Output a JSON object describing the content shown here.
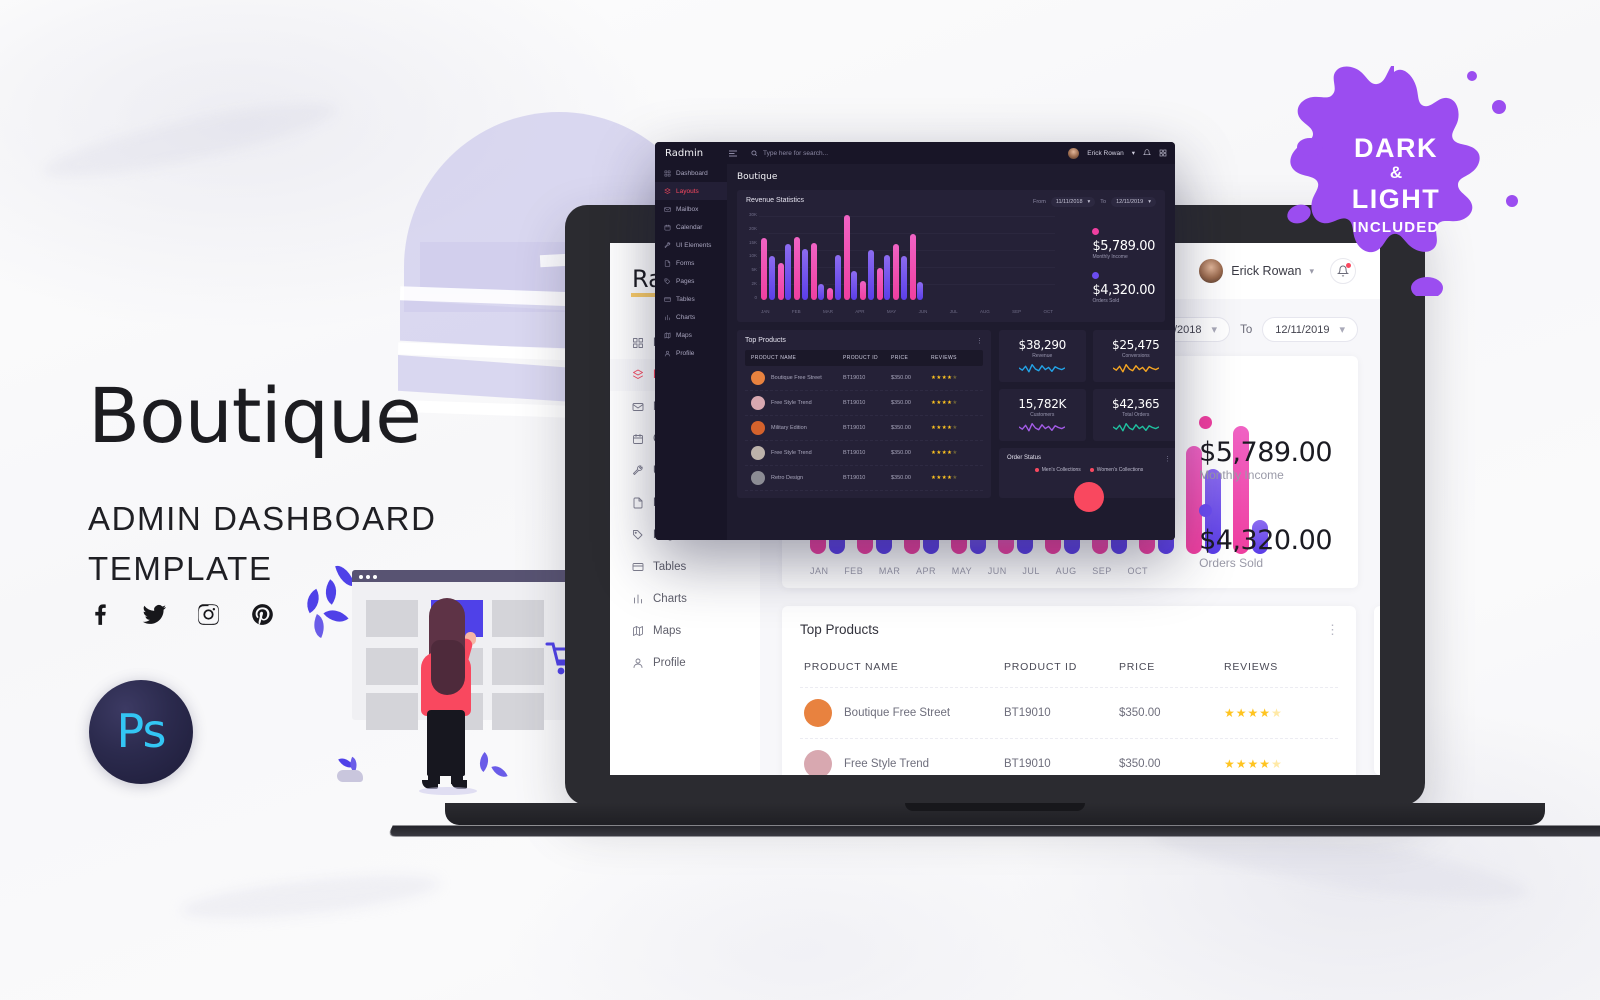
{
  "promo": {
    "brand_title": "Boutique",
    "subtitle_line1": "ADMIN DASHBOARD",
    "subtitle_line2": "TEMPLATE",
    "highlight_color": "#fbcd68",
    "social": [
      {
        "name": "facebook-icon",
        "label": "Facebook"
      },
      {
        "name": "twitter-icon",
        "label": "Twitter"
      },
      {
        "name": "instagram-icon",
        "label": "Instagram"
      },
      {
        "name": "pinterest-icon",
        "label": "Pinterest"
      }
    ],
    "photoshop_badge": "Ps"
  },
  "splat": {
    "line1": "DARK",
    "amp": "&",
    "line2": "LIGHT",
    "line3": "INCLUDED",
    "color": "#9b4df0"
  },
  "app": {
    "logo": "Radmin",
    "page_title": "Boutique",
    "search_placeholder": "Type here for search...",
    "user_name": "Erick Rowan",
    "menu": [
      {
        "label": "Dashboard",
        "icon": "grid-icon",
        "active": false
      },
      {
        "label": "Layouts",
        "icon": "layers-icon",
        "active": true
      },
      {
        "label": "Mailbox",
        "icon": "mail-icon",
        "active": false
      },
      {
        "label": "Calendar",
        "icon": "calendar-icon",
        "active": false
      },
      {
        "label": "UI Elements",
        "icon": "wrench-icon",
        "active": false
      },
      {
        "label": "Forms",
        "icon": "file-icon",
        "active": false
      },
      {
        "label": "Pages",
        "icon": "tag-icon",
        "active": false
      },
      {
        "label": "Tables",
        "icon": "table-icon",
        "active": false
      },
      {
        "label": "Charts",
        "icon": "bar-chart-icon",
        "active": false
      },
      {
        "label": "Maps",
        "icon": "map-icon",
        "active": false
      },
      {
        "label": "Profile",
        "icon": "user-icon",
        "active": false
      }
    ],
    "date_filter": {
      "from_label": "From",
      "from_value": "11/11/2018",
      "to_label": "To",
      "to_value": "12/11/2019"
    },
    "revenue_card_title": "Revenue Statistics",
    "order_status_title": "Order Status",
    "order_status_legend": [
      "Men's Collections",
      "Women's Collections"
    ],
    "legend": [
      {
        "value": "$5,789.00",
        "label": "Monthly Income",
        "color": "#ef3fa0"
      },
      {
        "value": "$4,320.00",
        "label": "Orders Sold",
        "color": "#6b4cf0"
      }
    ],
    "stats": [
      {
        "value": "$38,290",
        "label": "Revenue",
        "color": "#23a4e8"
      },
      {
        "value": "$25,475",
        "label": "Conversions",
        "color": "#f5a623"
      },
      {
        "value": "15,782K",
        "label": "Customers",
        "color": "#a45ce8"
      },
      {
        "value": "$42,365",
        "label": "Total Orders",
        "color": "#1fc2a0"
      }
    ],
    "products": {
      "title": "Top Products",
      "columns": [
        "PRODUCT NAME",
        "PRODUCT ID",
        "PRICE",
        "REVIEWS"
      ],
      "rows": [
        {
          "name": "Boutique Free Street",
          "id": "BT19010",
          "price": "$350.00",
          "rating": 4,
          "avatar": "#e8823f"
        },
        {
          "name": "Free Style Trend",
          "id": "BT19010",
          "price": "$350.00",
          "rating": 4,
          "avatar": "#d8a8b0"
        },
        {
          "name": "Military Edition",
          "id": "BT19010",
          "price": "$350.00",
          "rating": 4,
          "avatar": "#d4622c"
        },
        {
          "name": "Free Style Trend",
          "id": "BT19010",
          "price": "$350.00",
          "rating": 4,
          "avatar": "#bcb2aa"
        },
        {
          "name": "Retro Design",
          "id": "BT19010",
          "price": "$350.00",
          "rating": 4,
          "avatar": "#8c8c94"
        }
      ]
    }
  },
  "chart_data": {
    "type": "bar",
    "title": "Revenue Statistics",
    "xlabel": "",
    "ylabel": "",
    "ylim": [
      0,
      30000
    ],
    "ytick_labels": [
      "30K",
      "20K",
      "15K",
      "10K",
      "5K",
      "2K",
      "0"
    ],
    "grid": true,
    "legend_position": "right",
    "categories": [
      "JAN",
      "FEB",
      "MAR",
      "APR",
      "MAY",
      "JUN",
      "JUL",
      "AUG",
      "SEP",
      "OCT"
    ],
    "series": [
      {
        "name": "Monthly Income",
        "color": "#ef3fa0",
        "values": [
          21000,
          12500,
          21500,
          19500,
          4000,
          29000,
          6500,
          11000,
          19000,
          22500
        ]
      },
      {
        "name": "Orders Sold",
        "color": "#6b4cf0",
        "values": [
          15000,
          19000,
          17500,
          5500,
          15500,
          10000,
          17000,
          15500,
          15000,
          6000
        ]
      }
    ]
  }
}
